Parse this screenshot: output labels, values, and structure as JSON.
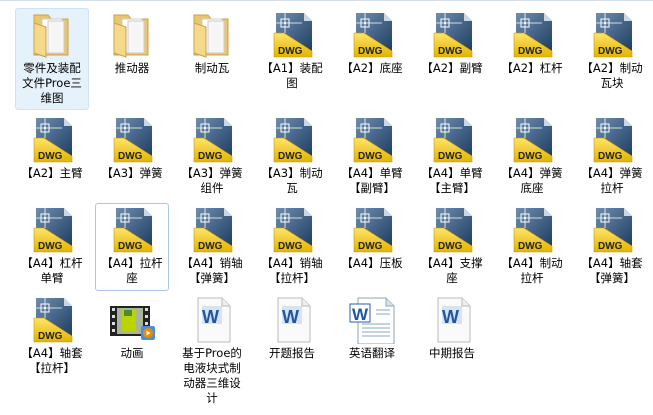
{
  "items": [
    {
      "label": "零件及装配文件Proe三维图",
      "type": "folder",
      "state": "selected"
    },
    {
      "label": "推动器",
      "type": "folder"
    },
    {
      "label": "制动瓦",
      "type": "folder"
    },
    {
      "label": "【A1】装配图",
      "type": "dwg"
    },
    {
      "label": "【A2】底座",
      "type": "dwg"
    },
    {
      "label": "【A2】副臂",
      "type": "dwg"
    },
    {
      "label": "【A2】杠杆",
      "type": "dwg"
    },
    {
      "label": "【A2】制动瓦块",
      "type": "dwg"
    },
    {
      "label": "【A2】主臂",
      "type": "dwg"
    },
    {
      "label": "【A3】弹簧",
      "type": "dwg"
    },
    {
      "label": "【A3】弹簧组件",
      "type": "dwg"
    },
    {
      "label": "【A3】制动瓦",
      "type": "dwg"
    },
    {
      "label": "【A4】单臂【副臂】",
      "type": "dwg"
    },
    {
      "label": "【A4】单臂【主臂】",
      "type": "dwg"
    },
    {
      "label": "【A4】弹簧底座",
      "type": "dwg"
    },
    {
      "label": "【A4】弹簧拉杆",
      "type": "dwg"
    },
    {
      "label": "【A4】杠杆单臂",
      "type": "dwg"
    },
    {
      "label": "【A4】拉杆座",
      "type": "dwg",
      "state": "focused"
    },
    {
      "label": "【A4】销轴【弹簧】",
      "type": "dwg"
    },
    {
      "label": "【A4】销轴【拉杆】",
      "type": "dwg"
    },
    {
      "label": "【A4】压板",
      "type": "dwg"
    },
    {
      "label": "【A4】支撑座",
      "type": "dwg"
    },
    {
      "label": "【A4】制动拉杆",
      "type": "dwg"
    },
    {
      "label": "【A4】轴套【弹簧】",
      "type": "dwg"
    },
    {
      "label": "【A4】轴套【拉杆】",
      "type": "dwg"
    },
    {
      "label": "动画",
      "type": "video"
    },
    {
      "label": "基于Proe的电液块式制动器三维设计",
      "type": "word"
    },
    {
      "label": "开题报告",
      "type": "word"
    },
    {
      "label": "英语翻译",
      "type": "word-large"
    },
    {
      "label": "中期报告",
      "type": "word"
    }
  ],
  "dwg_badge": "DWG",
  "word_badge": "W"
}
